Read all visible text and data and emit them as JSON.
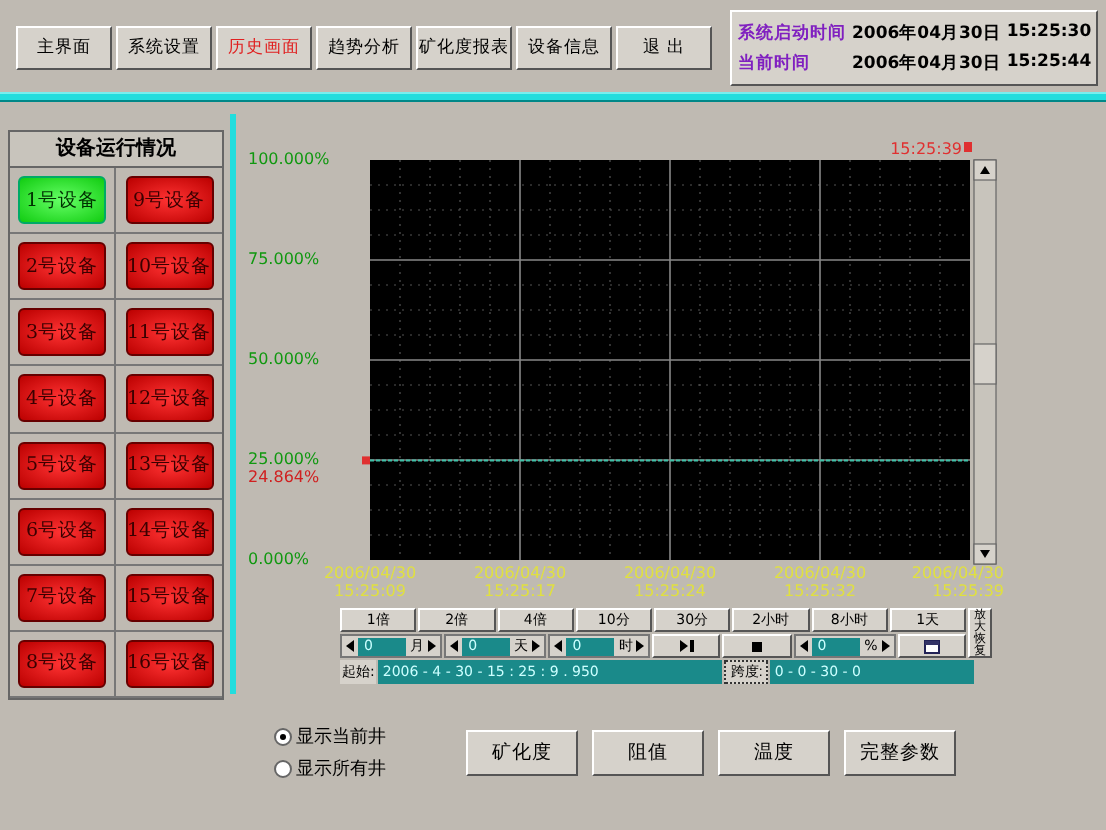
{
  "toolbar": {
    "buttons": [
      {
        "label": "主界面",
        "selected": false
      },
      {
        "label": "系统设置",
        "selected": false
      },
      {
        "label": "历史画面",
        "selected": true
      },
      {
        "label": "趋势分析",
        "selected": false
      },
      {
        "label": "矿化度报表",
        "selected": false
      },
      {
        "label": "设备信息",
        "selected": false
      },
      {
        "label": "退 出",
        "selected": false
      }
    ],
    "status": [
      {
        "label": "系统启动时间",
        "date": "2006年04月30日",
        "time": "15:25:30"
      },
      {
        "label": "当前时间",
        "date": "2006年04月30日",
        "time": "15:25:44"
      }
    ]
  },
  "devices": {
    "title": "设备运行情况",
    "items": [
      {
        "label": "1号设备",
        "running": true
      },
      {
        "label": "9号设备",
        "running": false
      },
      {
        "label": "2号设备",
        "running": false
      },
      {
        "label": "10号设备",
        "running": false
      },
      {
        "label": "3号设备",
        "running": false
      },
      {
        "label": "11号设备",
        "running": false
      },
      {
        "label": "4号设备",
        "running": false
      },
      {
        "label": "12号设备",
        "running": false
      },
      {
        "label": "5号设备",
        "running": false
      },
      {
        "label": "13号设备",
        "running": false
      },
      {
        "label": "6号设备",
        "running": false
      },
      {
        "label": "14号设备",
        "running": false
      },
      {
        "label": "7号设备",
        "running": false
      },
      {
        "label": "15号设备",
        "running": false
      },
      {
        "label": "8号设备",
        "running": false
      },
      {
        "label": "16号设备",
        "running": false
      }
    ]
  },
  "chart": {
    "cursor_time": "15:25:39",
    "reading": "24.864%",
    "chart_data": {
      "type": "line",
      "categories": [
        "2006/04/30 15:25:09",
        "2006/04/30 15:25:17",
        "2006/04/30 15:25:24",
        "2006/04/30 15:25:32",
        "2006/04/30 15:25:39"
      ],
      "grid": true,
      "series": [
        {
          "color": "#40c0a8",
          "line_style": "dashed",
          "values": [
            24.9,
            24.9,
            24.9,
            24.9,
            24.9
          ]
        }
      ],
      "ylim": [
        0,
        100
      ],
      "yticks": [
        {
          "value": 0,
          "label": "0.000%"
        },
        {
          "value": 25,
          "label": "25.000%"
        },
        {
          "value": 50,
          "label": "50.000%"
        },
        {
          "value": 75,
          "label": "75.000%"
        },
        {
          "value": 100,
          "label": "100.000%"
        }
      ]
    }
  },
  "controls": {
    "scale_buttons": [
      "1倍",
      "2倍",
      "4倍",
      "10分",
      "30分",
      "2小时",
      "8小时",
      "1天"
    ],
    "zoom_reset": "放大恢复",
    "row_2": [
      {
        "kind": "spinner",
        "value": "0",
        "unit": "月"
      },
      {
        "kind": "spinner",
        "value": "0",
        "unit": "天"
      },
      {
        "kind": "spinner",
        "value": "0",
        "unit": "时"
      },
      {
        "kind": "play"
      },
      {
        "kind": "stop"
      },
      {
        "kind": "spinner",
        "value": "0",
        "unit": "%"
      },
      {
        "kind": "calendar"
      }
    ],
    "start_label": "起始:",
    "start_value": "2006 - 4 - 30 - 15 : 25 : 9 . 950",
    "span_label": "跨度:",
    "span_value": "0 - 0 - 30 - 0"
  },
  "display_options": [
    {
      "label": "显示当前井",
      "selected": true
    },
    {
      "label": "显示所有井",
      "selected": false
    }
  ],
  "buttons": [
    "矿化度",
    "阻值",
    "温度",
    "完整参数"
  ]
}
